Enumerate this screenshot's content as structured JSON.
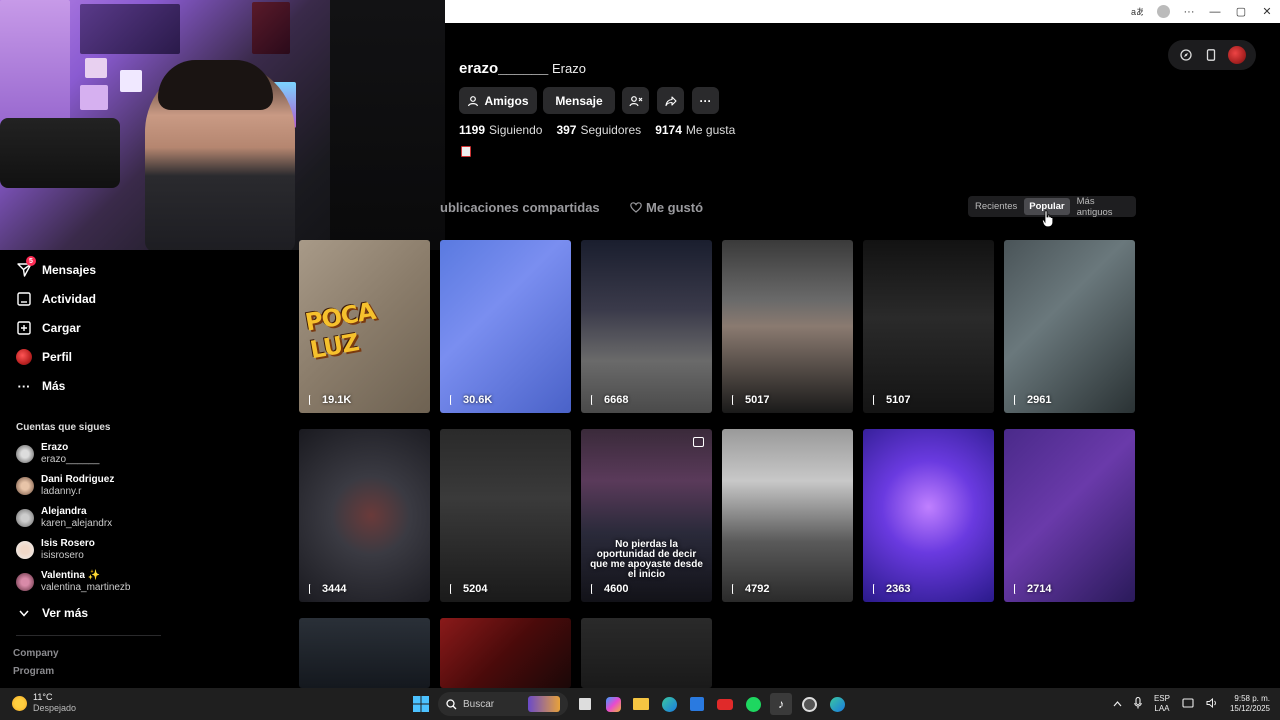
{
  "browser": {
    "icons": [
      "translate-icon",
      "profile-icon",
      "more-icon",
      "minimize-icon",
      "maximize-icon",
      "close-icon"
    ]
  },
  "profile": {
    "username": "erazo______",
    "nickname": "Erazo",
    "buttons": {
      "friends": "Amigos",
      "message": "Mensaje"
    },
    "stats": [
      {
        "value": "1199",
        "label": "Siguiendo"
      },
      {
        "value": "397",
        "label": "Seguidores"
      },
      {
        "value": "9174",
        "label": "Me gusta"
      }
    ]
  },
  "tabs": {
    "shared": "ublicaciones compartidas",
    "liked": "Me gustó"
  },
  "sort": {
    "options": [
      "Recientes",
      "Popular",
      "Más antiguos"
    ],
    "active": "Popular"
  },
  "sidebar": {
    "items": [
      {
        "label": "Mensajes",
        "icon": "send-icon",
        "badge": "5"
      },
      {
        "label": "Actividad",
        "icon": "inbox-icon"
      },
      {
        "label": "Cargar",
        "icon": "upload-icon"
      },
      {
        "label": "Perfil",
        "icon": "avatar-icon"
      },
      {
        "label": "Más",
        "icon": "more-icon"
      }
    ],
    "following_title": "Cuentas que sigues",
    "following": [
      {
        "name": "Erazo",
        "user": "erazo______"
      },
      {
        "name": "Dani Rodriguez",
        "user": "ladanny.r"
      },
      {
        "name": "Alejandra",
        "user": "karen_alejandrx"
      },
      {
        "name": "Isis Rosero",
        "user": "isisrosero"
      },
      {
        "name": "Valentina ✨",
        "user": "valentina_martinezb"
      }
    ],
    "see_more": "Ver más",
    "footer": [
      "Company",
      "Program"
    ]
  },
  "videos": [
    {
      "views": "19.1K",
      "caption": "POCA LUZ"
    },
    {
      "views": "30.6K"
    },
    {
      "views": "6668"
    },
    {
      "views": "5017"
    },
    {
      "views": "5107"
    },
    {
      "views": "2961"
    },
    {
      "views": "3444"
    },
    {
      "views": "5204"
    },
    {
      "views": "4600",
      "caption": "No pierdas la oportunidad de decir que me apoyaste desde el inicio"
    },
    {
      "views": "4792"
    },
    {
      "views": "2363"
    },
    {
      "views": "2714"
    },
    {
      "views": ""
    },
    {
      "views": ""
    },
    {
      "views": ""
    }
  ],
  "taskbar": {
    "weather_temp": "11°C",
    "weather_desc": "Despejado",
    "search_placeholder": "Buscar",
    "lang_top": "ESP",
    "lang_bottom": "LAA",
    "time": "9:58 p. m.",
    "date": "15/12/2025"
  },
  "colors": {
    "accent": "#fe2c55",
    "background": "#000000",
    "button": "#2a2a2c"
  }
}
